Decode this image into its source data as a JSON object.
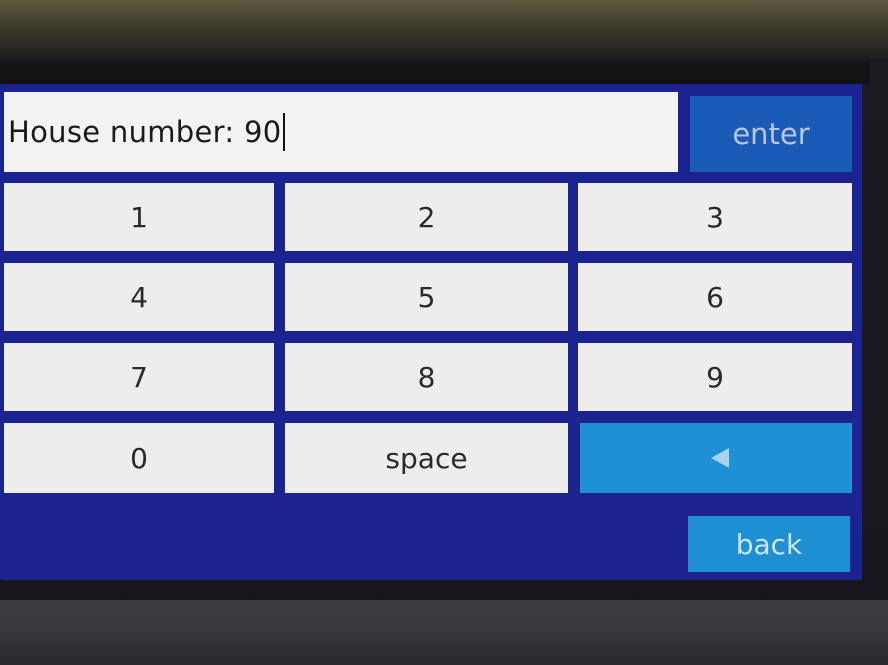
{
  "input": {
    "label": "House number:",
    "value": "90"
  },
  "actions": {
    "enter_label": "enter",
    "back_label": "back",
    "space_label": "space"
  },
  "keys": [
    "1",
    "2",
    "3",
    "4",
    "5",
    "6",
    "7",
    "8",
    "9",
    "0"
  ],
  "icons": {
    "backspace": "backspace-left-triangle-icon"
  },
  "colors": {
    "screen_background": "#1a2390",
    "key_background": "#ededed",
    "enter_button": "#1a5bb8",
    "accent_button": "#1f8fd4"
  }
}
